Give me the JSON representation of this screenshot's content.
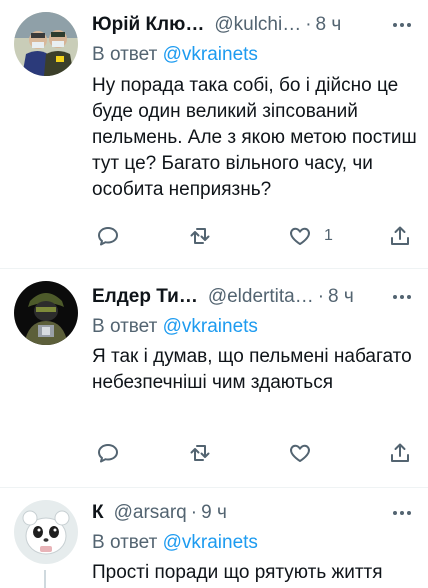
{
  "tweets": [
    {
      "author_name": "Юрій Клю…",
      "handle": "@kulchi…",
      "separator": "·",
      "time": "8 ч",
      "reply_prefix": "В ответ",
      "reply_to": "@vkrainets",
      "text": "Ну порада така собі, бо і дійсно це буде один великий зіпсований пельмень. Але з якою метою постиш тут це? Багато вільного часу, чи особита неприязнь?",
      "like_count": "1"
    },
    {
      "author_name": "Елдер Ти…",
      "handle": "@eldertita…",
      "separator": "·",
      "time": "8 ч",
      "reply_prefix": "В ответ",
      "reply_to": "@vkrainets",
      "text": "Я так і думав, що пельмені набагато небезпечніші чим здаються",
      "like_count": ""
    },
    {
      "author_name": "К",
      "handle": "@arsarq",
      "separator": "·",
      "time": "9 ч",
      "reply_prefix": "В ответ",
      "reply_to": "@vkrainets",
      "text": "Прості поради що рятують життя"
    }
  ],
  "colors": {
    "accent": "#1d9bf0",
    "secondary_text": "#536471",
    "divider": "#eff3f4"
  },
  "icons": [
    "reply-icon",
    "retweet-icon",
    "like-icon",
    "share-icon",
    "more-icon"
  ]
}
